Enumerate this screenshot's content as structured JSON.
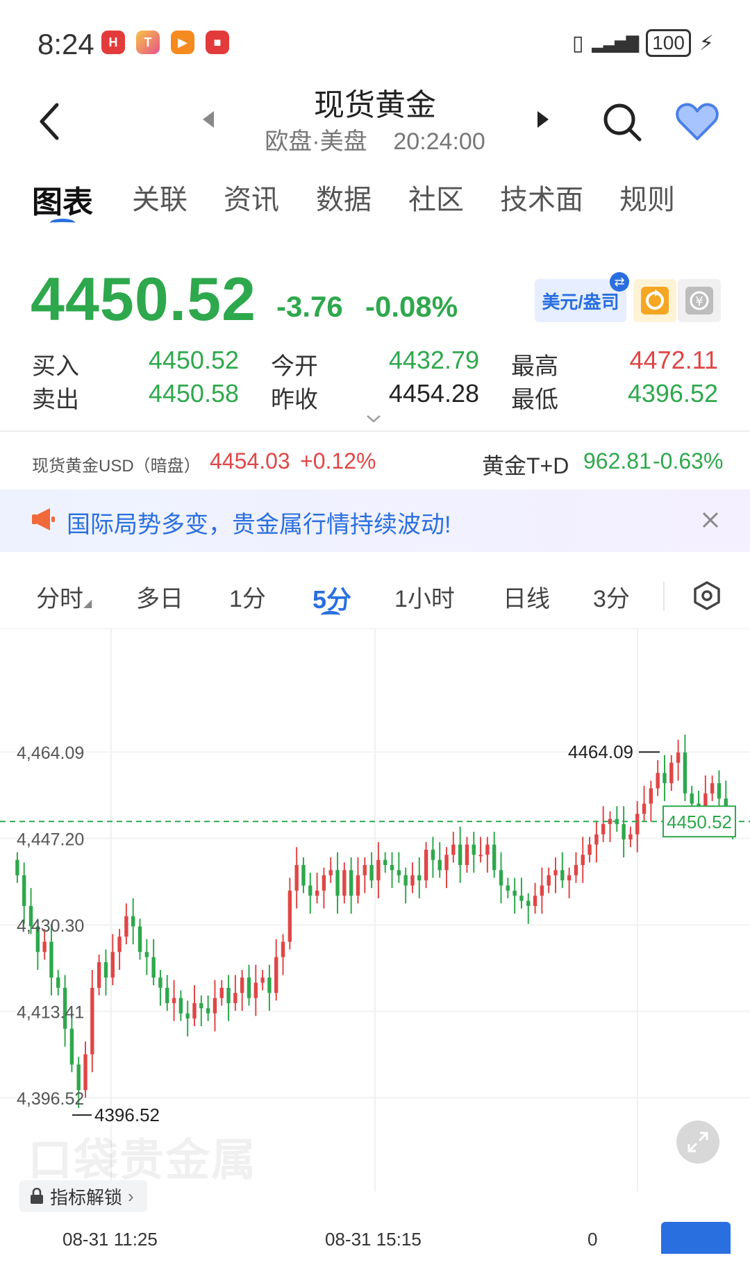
{
  "status_bar": {
    "time": "8:24",
    "battery": "100",
    "apps": [
      {
        "icon": "huawei-app-icon",
        "color": "#e33b3b"
      },
      {
        "icon": "paint-app-icon",
        "color": "#f0a030"
      },
      {
        "icon": "video-app-icon",
        "color": "#f58a1f"
      },
      {
        "icon": "store-app-icon",
        "color": "#e33b3b"
      }
    ]
  },
  "header": {
    "title": "现货黄金",
    "session": "欧盘·美盘",
    "clock": "20:24:00"
  },
  "tabs": [
    "图表",
    "关联",
    "资讯",
    "数据",
    "社区",
    "技术面",
    "规则"
  ],
  "active_tab": 0,
  "quote": {
    "price": "4450.52",
    "change": "-3.76",
    "change_pct": "-0.08%",
    "currency_button": "美元/盎司"
  },
  "stats": {
    "buy_label": "买入",
    "buy": "4450.52",
    "sell_label": "卖出",
    "sell": "4450.58",
    "open_label": "今开",
    "open": "4432.79",
    "prev_close_label": "昨收",
    "prev_close": "4454.28",
    "high_label": "最高",
    "high": "4472.11",
    "low_label": "最低",
    "low": "4396.52"
  },
  "related": {
    "left_name": "现货黄金USD（暗盘）",
    "left_value": "4454.03",
    "left_change": "+0.12%",
    "right_name": "黄金T+D",
    "right_value": "962.81",
    "right_change": "-0.63%"
  },
  "notice": {
    "text": "国际局势多变，贵金属行情持续波动!"
  },
  "periods": [
    "分时",
    "多日",
    "1分",
    "5分",
    "1小时",
    "日线",
    "3分"
  ],
  "active_period": 3,
  "chart_labels": {
    "y_ticks": [
      "4,464.09",
      "4,447.20",
      "4,430.30",
      "4,413.41",
      "4,396.52"
    ],
    "max_marker": "4464.09",
    "min_marker": "4396.52",
    "current_tag": "4450.52",
    "x_ticks": [
      "08-31 11:25",
      "08-31 15:15",
      "0"
    ],
    "watermark": "口袋贵金属",
    "lock_button": "指标解锁"
  },
  "chart_data": {
    "type": "candlestick",
    "interval": "5分",
    "y_ticks": [
      4396.52,
      4413.41,
      4430.3,
      4447.2,
      4464.09
    ],
    "ylim": [
      4385,
      4480
    ],
    "high_marker": 4464.09,
    "low_marker": 4396.52,
    "current_price": 4450.52,
    "up_color": "#e04646",
    "down_color": "#2ea84c",
    "series": [
      {
        "name": "close",
        "values": [
          4440,
          4434,
          4430,
          4425,
          4427,
          4420,
          4418,
          4410,
          4403,
          4398,
          4405,
          4418,
          4423,
          4420,
          4425,
          4428,
          4432,
          4430,
          4425,
          4424,
          4420,
          4418,
          4415,
          4416,
          4413,
          4412,
          4415,
          4414,
          4413,
          4416,
          4418,
          4415,
          4417,
          4420,
          4416,
          4419,
          4420,
          4417,
          4424,
          4427,
          4437,
          4442,
          4438,
          4436,
          4437,
          4440,
          4441,
          4436,
          4441,
          4436,
          4440,
          4442,
          4439,
          4443,
          4442,
          4441,
          4440,
          4438,
          4440,
          4439,
          4445,
          4443,
          4441,
          4444,
          4446,
          4442,
          4446,
          4444,
          4444,
          4446,
          4441,
          4438,
          4437,
          4436,
          4435,
          4434,
          4436,
          4438,
          4440,
          4441,
          4439,
          4440,
          4442,
          4444,
          4446,
          4448,
          4450,
          4451,
          4450,
          4447,
          4448,
          4452,
          4454,
          4457,
          4460,
          4458,
          4462,
          4464,
          4456,
          4454,
          4452,
          4456,
          4458,
          4455,
          4452,
          4450.52
        ]
      }
    ]
  }
}
